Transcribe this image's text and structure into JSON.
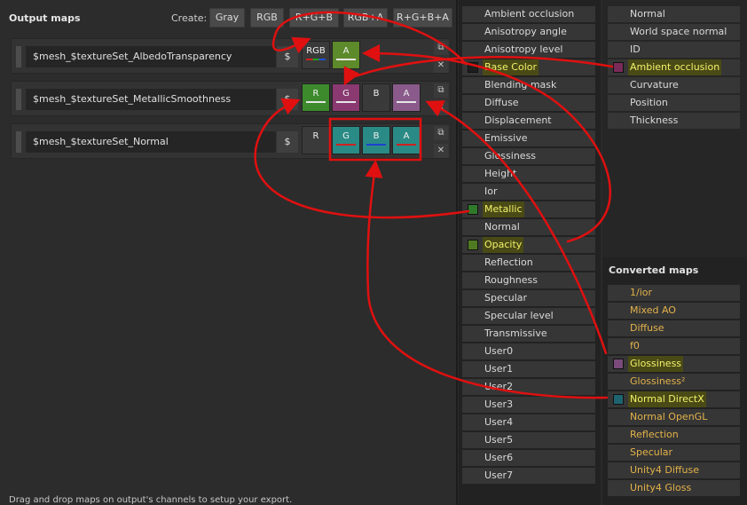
{
  "header": {
    "title": "Output maps",
    "create_label": "Create:",
    "create_buttons": [
      "Gray",
      "RGB",
      "R+G+B",
      "RGB+A",
      "R+G+B+A"
    ]
  },
  "rows": [
    {
      "name": "$mesh_$textureSet_AlbedoTransparency",
      "dollar": "$",
      "channels": [
        {
          "label": "RGB",
          "color": "#3a3a3a"
        },
        {
          "label": "A",
          "color": "#5d8a2a"
        }
      ]
    },
    {
      "name": "$mesh_$textureSet_MetallicSmoothness",
      "dollar": "$",
      "channels": [
        {
          "label": "R",
          "color": "#3c8a2c"
        },
        {
          "label": "G",
          "color": "#8a3a70"
        },
        {
          "label": "B",
          "color": "#3a3a3a"
        },
        {
          "label": "A",
          "color": "#8a5a8a"
        }
      ]
    },
    {
      "name": "$mesh_$textureSet_Normal",
      "dollar": "$",
      "channels": [
        {
          "label": "R",
          "color": "#3a3a3a"
        },
        {
          "label": "G",
          "color": "#2a8a86"
        },
        {
          "label": "B",
          "color": "#2a8a86"
        },
        {
          "label": "A",
          "color": "#2a8a86"
        }
      ]
    }
  ],
  "hint": "Drag and drop maps on output's channels to setup your export.",
  "mesh_maps": [
    "Ambient occlusion",
    "Anisotropy angle",
    "Anisotropy level",
    "Base Color",
    "Blending mask",
    "Diffuse",
    "Displacement",
    "Emissive",
    "Glossiness",
    "Height",
    "Ior",
    "Metallic",
    "Normal",
    "Opacity",
    "Reflection",
    "Roughness",
    "Specular",
    "Specular level",
    "Transmissive",
    "User0",
    "User1",
    "User2",
    "User3",
    "User4",
    "User5",
    "User6",
    "User7"
  ],
  "baked_maps": [
    "Normal",
    "World space normal",
    "ID",
    "Ambient occlusion",
    "Curvature",
    "Position",
    "Thickness"
  ],
  "converted_title": "Converted maps",
  "converted_maps": [
    "1/ior",
    "Mixed AO",
    "Diffuse",
    "f0",
    "Glossiness",
    "Glossiness²",
    "Normal DirectX",
    "Normal OpenGL",
    "Reflection",
    "Specular",
    "Unity4 Diffuse",
    "Unity4 Gloss"
  ],
  "colors": {
    "base_color": "#1e1e1e",
    "metallic": "#2f7a2a",
    "opacity": "#4f7a22",
    "ambient_occlusion": "#7a2a58",
    "glossiness": "#7a4a7a",
    "normal_directx": "#1e6470",
    "arrow": "#e01010"
  }
}
